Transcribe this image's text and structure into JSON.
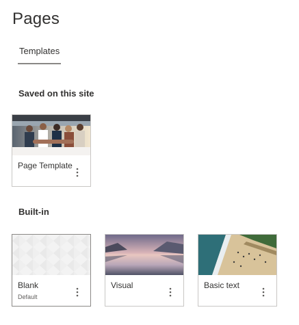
{
  "page": {
    "title": "Pages"
  },
  "tabs": [
    {
      "label": "Templates"
    }
  ],
  "saved": {
    "heading": "Saved on this site",
    "cards": [
      {
        "name": "Page Template"
      }
    ]
  },
  "builtin": {
    "heading": "Built-in",
    "cards": [
      {
        "name": "Blank",
        "sub": "Default"
      },
      {
        "name": "Visual"
      },
      {
        "name": "Basic text"
      }
    ]
  },
  "icons": {
    "more": "more-vertical-icon"
  }
}
